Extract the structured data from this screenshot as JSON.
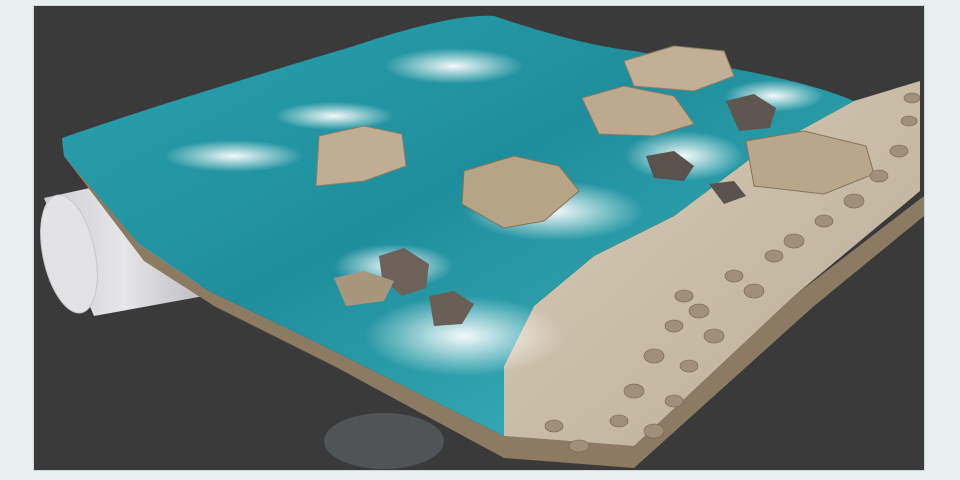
{
  "viewport": {
    "background": "#3a3a3b",
    "page_background": "#e9eef1",
    "object": "coastal-terrain-scan",
    "colors": {
      "water_deep": "#1f8e9c",
      "water_light": "#4cc6cf",
      "foam": "#e9f4f3",
      "sand": "#cfc3ad",
      "rock": "#b9a78c",
      "rock_dark": "#6e625a",
      "cylinder": "#d9d9dc"
    }
  }
}
